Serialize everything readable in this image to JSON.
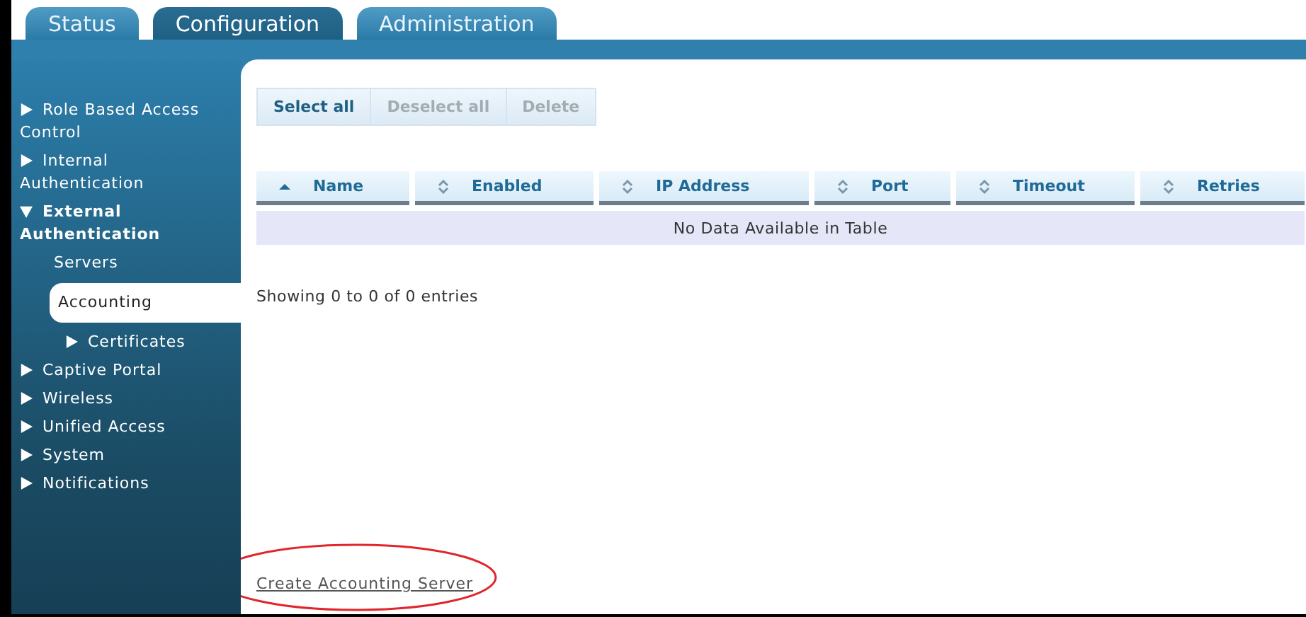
{
  "tabs": [
    {
      "label": "Status",
      "selected": false
    },
    {
      "label": "Configuration",
      "selected": true
    },
    {
      "label": "Administration",
      "selected": false
    }
  ],
  "sidebar": {
    "items": [
      {
        "label": "Role Based Access Control",
        "expanded": false,
        "selected": false
      },
      {
        "label": "Internal Authentication",
        "expanded": false,
        "selected": false
      },
      {
        "label": "External Authentication",
        "expanded": true,
        "selected": false,
        "children": [
          {
            "label": "Servers",
            "selected": false
          },
          {
            "label": "Accounting",
            "selected": true
          },
          {
            "label": "Certificates",
            "expanded": false,
            "selected": false
          }
        ]
      },
      {
        "label": "Captive Portal",
        "expanded": false,
        "selected": false
      },
      {
        "label": "Wireless",
        "expanded": false,
        "selected": false
      },
      {
        "label": "Unified Access",
        "expanded": false,
        "selected": false
      },
      {
        "label": "System",
        "expanded": false,
        "selected": false
      },
      {
        "label": "Notifications",
        "expanded": false,
        "selected": false
      }
    ]
  },
  "toolbar": [
    {
      "label": "Select all",
      "disabled": false
    },
    {
      "label": "Deselect all",
      "disabled": true
    },
    {
      "label": "Delete",
      "disabled": true
    }
  ],
  "table": {
    "columns": [
      {
        "label": "Name",
        "sorted": true
      },
      {
        "label": "Enabled",
        "sorted": false
      },
      {
        "label": "IP Address",
        "sorted": false
      },
      {
        "label": "Port",
        "sorted": false
      },
      {
        "label": "Timeout",
        "sorted": false
      },
      {
        "label": "Retries",
        "sorted": false
      }
    ],
    "empty_message": "No Data Available in Table"
  },
  "info": "Showing 0 to 0 of 0 entries",
  "create_link": {
    "label": "Create Accounting Server",
    "highlighted": true
  }
}
